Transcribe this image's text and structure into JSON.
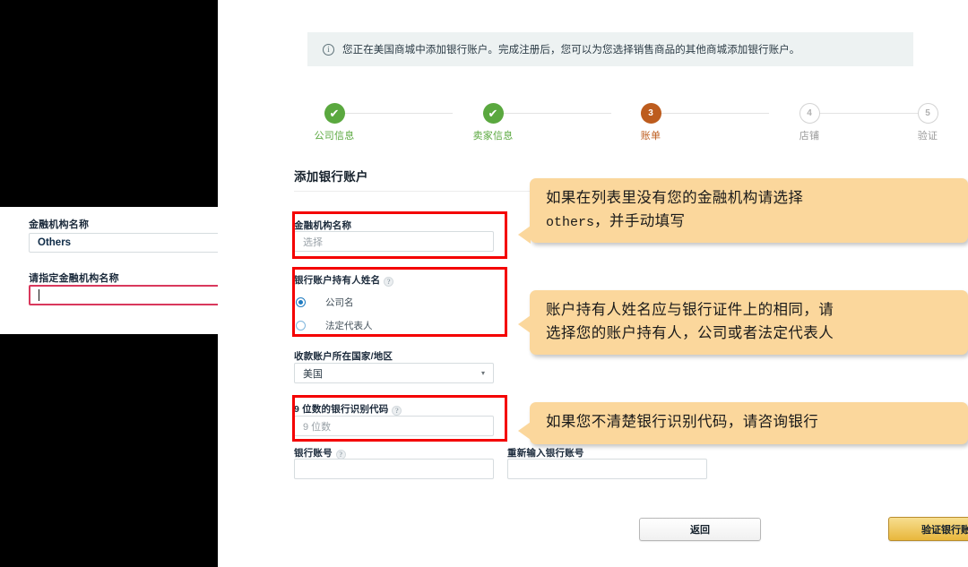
{
  "banner": {
    "icon": "info-circle-icon",
    "text": "您正在美国商城中添加银行账户。完成注册后，您可以为您选择销售商品的其他商城添加银行账户。",
    "background": "#edf2f2"
  },
  "stepper": {
    "done_color": "#5aa83f",
    "current_color": "#bd5c1e",
    "todo_color": "#b0b0b0",
    "steps": [
      {
        "number": "1",
        "label": "公司信息",
        "state": "done",
        "mark": "✔"
      },
      {
        "number": "2",
        "label": "卖家信息",
        "state": "done",
        "mark": "✔"
      },
      {
        "number": "3",
        "label": "账单",
        "state": "current",
        "mark": "3"
      },
      {
        "number": "4",
        "label": "店铺",
        "state": "todo",
        "mark": "4"
      },
      {
        "number": "5",
        "label": "验证",
        "state": "todo",
        "mark": "5"
      }
    ]
  },
  "form": {
    "title": "添加银行账户",
    "institution": {
      "label": "金融机构名称",
      "placeholder": "选择"
    },
    "holder": {
      "label": "银行账户持有人姓名",
      "help": "?",
      "options": [
        {
          "label": "公司名",
          "selected": true
        },
        {
          "label": "法定代表人",
          "selected": false
        }
      ]
    },
    "country": {
      "label": "收款账户所在国家/地区",
      "value": "美国",
      "caret": "▾"
    },
    "routing": {
      "label": "9 位数的银行识别代码",
      "help": "?",
      "placeholder": "9 位数"
    },
    "account_number": {
      "label": "银行账号",
      "help": "?",
      "value": ""
    },
    "account_number_confirm": {
      "label": "重新输入银行账号",
      "value": ""
    }
  },
  "buttons": {
    "back": "返回",
    "verify": "验证银行账户"
  },
  "callouts": [
    {
      "line1": "如果在列表里没有您的金融机构请选择",
      "line2_mono": "others",
      "line2_rest": "，并手动填写",
      "color": "#fbd79c"
    },
    {
      "line1": "账户持有人姓名应与银行证件上的相同，请",
      "line2": "选择您的账户持有人，公司或者法定代表人",
      "color": "#fbd79c"
    },
    {
      "line1": "如果您不清楚银行识别代码，请咨询银行",
      "color": "#fbd79c"
    }
  ],
  "inset_panel": {
    "institution_label": "金融机构名称",
    "institution_value": "Others",
    "specify_label": "请指定金融机构名称",
    "specify_value": "",
    "highlight_color": "#d9385c"
  },
  "highlight_boxes": {
    "color": "#f40000",
    "count": 3
  }
}
